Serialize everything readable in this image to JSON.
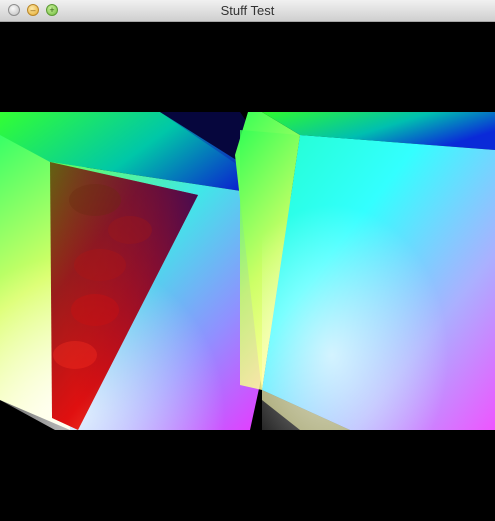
{
  "window": {
    "title": "Stuff Test"
  },
  "controls": {
    "close_glyph": "",
    "minimize_glyph": "–",
    "zoom_glyph": "+"
  },
  "icons": {
    "close": "close-icon",
    "minimize": "minimize-icon",
    "zoom": "zoom-icon"
  },
  "colors": {
    "background": "#000000",
    "titlebar": "#e6e6e6"
  }
}
